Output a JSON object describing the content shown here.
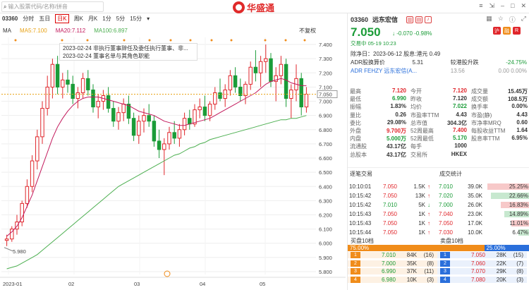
{
  "search": {
    "placeholder": "输入股票代码/名称/拼音"
  },
  "brand": {
    "name": "华盛通"
  },
  "window": {
    "controls": [
      "≡",
      "⇲",
      "–",
      "□",
      "✕"
    ]
  },
  "chart_toolbar": {
    "code": "03360",
    "tabs": [
      "分时",
      "五日",
      "日K",
      "周K",
      "月K",
      "1分",
      "5分",
      "15分"
    ],
    "active": "日K"
  },
  "ma": {
    "label": "MA",
    "ma5": "MA5:7.100",
    "ma20": "MA20:7.112",
    "ma100": "MA100:6.897",
    "adjust": "不复权"
  },
  "tooltip": {
    "lines": [
      "2023-02-24 非执行董事辞任及委任执行董事、非...",
      "2023-02-24 董事名单与其角色职能"
    ]
  },
  "chart_data": {
    "type": "candlestick",
    "title": "",
    "y_ticks": [
      7.4,
      7.3,
      7.2,
      7.1,
      7.0,
      6.9,
      6.8,
      6.7,
      6.6,
      6.5,
      6.4,
      6.3,
      6.2,
      6.1,
      6.0,
      5.9,
      5.8
    ],
    "ylim": [
      5.78,
      7.45
    ],
    "x_ticks": [
      "2023-01",
      "02",
      "03",
      "04",
      "05"
    ],
    "current_price": "7.050",
    "low_marker": "5.980",
    "series": [
      {
        "name": "candles",
        "ohlc": [
          [
            6.02,
            6.06,
            5.98,
            6.03
          ],
          [
            6.03,
            6.12,
            6.01,
            6.1
          ],
          [
            6.1,
            6.2,
            6.06,
            6.15
          ],
          [
            6.15,
            6.3,
            6.12,
            6.28
          ],
          [
            6.28,
            6.45,
            6.25,
            6.4
          ],
          [
            6.4,
            6.62,
            6.36,
            6.58
          ],
          [
            6.58,
            6.8,
            6.52,
            6.75
          ],
          [
            6.75,
            7.0,
            6.7,
            6.95
          ],
          [
            6.95,
            7.18,
            6.9,
            7.1
          ],
          [
            7.1,
            7.3,
            7.02,
            7.26
          ],
          [
            7.26,
            7.32,
            7.05,
            7.1
          ],
          [
            7.1,
            7.2,
            7.02,
            7.15
          ],
          [
            7.15,
            7.22,
            7.06,
            7.12
          ],
          [
            7.12,
            7.18,
            6.98,
            7.02
          ],
          [
            7.02,
            7.1,
            6.95,
            7.06
          ],
          [
            7.06,
            7.2,
            7.02,
            7.16
          ],
          [
            7.16,
            7.22,
            7.04,
            7.08
          ],
          [
            7.08,
            7.12,
            6.92,
            6.96
          ],
          [
            6.96,
            7.05,
            6.88,
            7.0
          ],
          [
            7.0,
            7.08,
            6.94,
            7.04
          ],
          [
            7.04,
            7.1,
            6.92,
            6.95
          ],
          [
            6.95,
            7.0,
            6.82,
            6.86
          ],
          [
            6.86,
            6.96,
            6.8,
            6.92
          ],
          [
            6.92,
            7.02,
            6.86,
            6.98
          ],
          [
            6.98,
            7.04,
            6.84,
            6.88
          ],
          [
            6.88,
            6.92,
            6.72,
            6.76
          ],
          [
            6.76,
            6.9,
            6.7,
            6.86
          ],
          [
            6.86,
            6.95,
            6.78,
            6.9
          ],
          [
            6.9,
            6.98,
            6.82,
            6.86
          ],
          [
            6.86,
            6.9,
            6.68,
            6.72
          ],
          [
            6.72,
            6.8,
            6.6,
            6.66
          ],
          [
            6.66,
            6.74,
            6.48,
            6.7
          ],
          [
            6.7,
            6.82,
            6.66,
            6.78
          ],
          [
            6.78,
            6.86,
            6.7,
            6.74
          ],
          [
            6.74,
            6.84,
            6.68,
            6.8
          ],
          [
            6.8,
            6.92,
            6.76,
            6.88
          ],
          [
            6.88,
            6.94,
            6.8,
            6.84
          ],
          [
            6.84,
            6.98,
            6.82,
            6.94
          ],
          [
            6.94,
            7.02,
            6.88,
            6.96
          ],
          [
            6.96,
            7.04,
            6.86,
            6.9
          ],
          [
            6.9,
            7.0,
            6.86,
            6.98
          ],
          [
            6.98,
            7.1,
            6.94,
            7.06
          ],
          [
            7.06,
            7.16,
            7.0,
            7.02
          ],
          [
            7.02,
            7.12,
            6.96,
            7.08
          ],
          [
            7.08,
            7.22,
            7.04,
            7.18
          ],
          [
            7.18,
            7.24,
            7.06,
            7.1
          ],
          [
            7.1,
            7.16,
            7.0,
            7.04
          ],
          [
            7.04,
            7.14,
            6.98,
            7.12
          ],
          [
            7.12,
            7.28,
            7.08,
            7.24
          ],
          [
            7.24,
            7.36,
            7.14,
            7.2
          ],
          [
            7.2,
            7.32,
            7.1,
            7.28
          ],
          [
            7.28,
            7.4,
            7.2,
            7.3
          ],
          [
            7.3,
            7.34,
            7.1,
            7.14
          ],
          [
            7.14,
            7.24,
            7.0,
            7.18
          ],
          [
            7.18,
            7.32,
            7.12,
            7.26
          ],
          [
            7.26,
            7.3,
            6.96,
            7.02
          ],
          [
            7.02,
            7.12,
            6.88,
            7.08
          ],
          [
            7.08,
            7.26,
            7.0,
            7.16
          ],
          [
            7.16,
            7.2,
            6.9,
            6.96
          ],
          [
            6.96,
            7.1,
            6.92,
            7.05
          ]
        ]
      },
      {
        "name": "MA20",
        "values": [
          6.05,
          6.08,
          6.12,
          6.18,
          6.26,
          6.34,
          6.44,
          6.54,
          6.64,
          6.74,
          6.82,
          6.88,
          6.93,
          6.97,
          7.0,
          7.02,
          7.03,
          7.03,
          7.03,
          7.02,
          7.01,
          7.0,
          6.99,
          6.98,
          6.97,
          6.95,
          6.93,
          6.92,
          6.91,
          6.9,
          6.88,
          6.86,
          6.85,
          6.84,
          6.83,
          6.83,
          6.84,
          6.85,
          6.86,
          6.87,
          6.88,
          6.9,
          6.92,
          6.94,
          6.96,
          6.98,
          7.0,
          7.02,
          7.04,
          7.06,
          7.09,
          7.12,
          7.14,
          7.15,
          7.16,
          7.15,
          7.13,
          7.12,
          7.11,
          7.11
        ]
      },
      {
        "name": "MA100",
        "values": [
          5.82,
          5.83,
          5.84,
          5.86,
          5.88,
          5.9,
          5.92,
          5.95,
          5.98,
          6.01,
          6.04,
          6.07,
          6.1,
          6.13,
          6.16,
          6.19,
          6.22,
          6.25,
          6.28,
          6.31,
          6.34,
          6.37,
          6.4,
          6.42,
          6.44,
          6.46,
          6.48,
          6.5,
          6.52,
          6.54,
          6.56,
          6.58,
          6.6,
          6.62,
          6.63,
          6.65,
          6.67,
          6.68,
          6.7,
          6.71,
          6.73,
          6.74,
          6.75,
          6.76,
          6.77,
          6.78,
          6.79,
          6.8,
          6.81,
          6.82,
          6.83,
          6.84,
          6.85,
          6.86,
          6.87,
          6.87,
          6.88,
          6.88,
          6.89,
          6.9
        ]
      }
    ]
  },
  "quote": {
    "code": "03360",
    "name": "远东宏信",
    "price": "7.050",
    "change": "-0.070",
    "pct": "-0.98%",
    "status": "交易中 05-19 10:23"
  },
  "badges": [
    "沪",
    "融",
    "R"
  ],
  "info": {
    "line1": "除净日：2023-06-12 股息:港元 0.49",
    "adr_label": "ADR股换算价",
    "adr_value": "5.31",
    "adr_tag": "较港股升跌",
    "adr_pct": "-24.75%",
    "adr2": "ADR  FEHZY 远东宏信(A...",
    "adr2_val": "13.56",
    "adr2_chg": "0.00  0.00%"
  },
  "stats": [
    [
      [
        "最高",
        "7.120"
      ],
      [
        "今开",
        "7.120"
      ],
      [
        "成交量",
        "15.45万"
      ]
    ],
    [
      [
        "最低",
        "6.990"
      ],
      [
        "昨收",
        "7.120"
      ],
      [
        "成交额",
        "108.5万"
      ]
    ],
    [
      [
        "振幅",
        "1.83%"
      ],
      [
        "均价",
        "7.022"
      ],
      [
        "换手率",
        "0.00%"
      ]
    ],
    [
      [
        "量比",
        "0.26"
      ],
      [
        "市盈率TTM",
        "4.43"
      ],
      [
        "市盈(静)",
        "4.43"
      ]
    ],
    [
      [
        "委比",
        "29.08%"
      ],
      [
        "总市值",
        "304.3亿"
      ],
      [
        "市净率MRQ",
        "0.60"
      ]
    ],
    [
      [
        "外盘",
        "9.700万"
      ],
      [
        "52周最高",
        "7.400"
      ],
      [
        "每股收益TTM",
        "1.64"
      ]
    ],
    [
      [
        "内盘",
        "5.000万"
      ],
      [
        "52周最低",
        "5.170"
      ],
      [
        "股息率TTM",
        "6.95%"
      ]
    ],
    [
      [
        "流通股",
        "43.17亿"
      ],
      [
        "每手",
        "1000"
      ],
      [
        "",
        ""
      ]
    ],
    [
      [
        "总股本",
        "43.17亿"
      ],
      [
        "交易所",
        "HKEX"
      ],
      [
        "",
        ""
      ]
    ]
  ],
  "ticks": {
    "title": "逐笔交易",
    "rows": [
      [
        "10:10:01",
        "7.050",
        "1.5K",
        "up"
      ],
      [
        "10:15:42",
        "7.050",
        "13K",
        "up"
      ],
      [
        "10:15:42",
        "7.010",
        "5K",
        "down"
      ],
      [
        "10:15:43",
        "7.050",
        "1K",
        "up"
      ],
      [
        "10:15:43",
        "7.050",
        "1K",
        "up"
      ],
      [
        "10:15:44",
        "7.050",
        "1K",
        "up"
      ]
    ]
  },
  "vstats": {
    "title": "成交统计",
    "rows": [
      [
        "7.010",
        "39.0K",
        "25.25%",
        0.25
      ],
      [
        "7.020",
        "35.0K",
        "22.66%",
        0.23
      ],
      [
        "7.000",
        "26.0K",
        "16.83%",
        0.17
      ],
      [
        "7.040",
        "23.0K",
        "14.89%",
        0.15
      ],
      [
        "7.050",
        "17.0K",
        "11.01%",
        0.11
      ],
      [
        "7.030",
        "10.0K",
        "6.47%",
        0.065
      ]
    ]
  },
  "book": {
    "buy_title": "买盘10档",
    "sell_title": "卖盘10档",
    "buy_ratio": "75.00%",
    "sell_ratio": "25.00%",
    "buy_share": 0.75,
    "buy": [
      [
        "1",
        "7.010",
        "84K",
        "(16)"
      ],
      [
        "2",
        "7.000",
        "35K",
        "(8)"
      ],
      [
        "3",
        "6.990",
        "37K",
        "(11)"
      ],
      [
        "4",
        "6.980",
        "10K",
        "(3)"
      ]
    ],
    "sell": [
      [
        "1",
        "7.050",
        "28K",
        "(15)"
      ],
      [
        "2",
        "7.060",
        "22K",
        "(7)"
      ],
      [
        "3",
        "7.070",
        "29K",
        "(8)"
      ],
      [
        "4",
        "7.080",
        "20K",
        "(3)"
      ]
    ]
  },
  "colors": {
    "up": "#e0262b",
    "down": "#1b9c38",
    "ma5": "#e8a317",
    "ma20": "#c2185b",
    "ma100": "#4caf50",
    "blue": "#2a6fdb"
  }
}
